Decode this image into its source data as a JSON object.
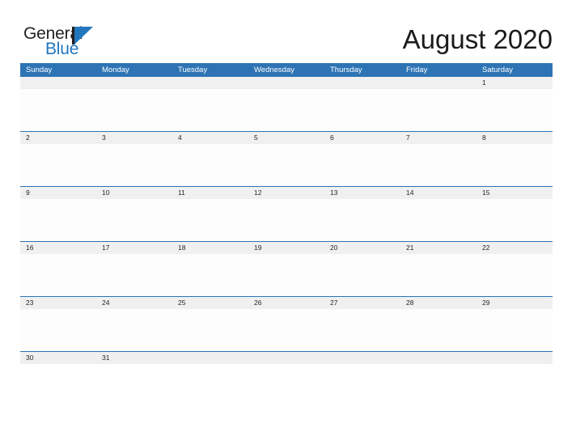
{
  "brand": {
    "word_one": "General",
    "word_two": "Blue",
    "mark": "triangle-logo-mark",
    "color_dark": "#231f20",
    "color_blue": "#2176bd"
  },
  "header": {
    "title": "August 2020"
  },
  "colors": {
    "header_blue": "#2e74b5",
    "row_gray": "#f0f0f0",
    "rule_blue": "#2e74b5",
    "page_background": "#ffffff"
  },
  "calendar": {
    "month": "August",
    "year": "2020",
    "day_headers": [
      "Sunday",
      "Monday",
      "Tuesday",
      "Wednesday",
      "Thursday",
      "Friday",
      "Saturday"
    ],
    "weeks": [
      {
        "days": [
          "",
          "",
          "",
          "",
          "",
          "",
          "1"
        ]
      },
      {
        "days": [
          "2",
          "3",
          "4",
          "5",
          "6",
          "7",
          "8"
        ]
      },
      {
        "days": [
          "9",
          "10",
          "11",
          "12",
          "13",
          "14",
          "15"
        ]
      },
      {
        "days": [
          "16",
          "17",
          "18",
          "19",
          "20",
          "21",
          "22"
        ]
      },
      {
        "days": [
          "23",
          "24",
          "25",
          "26",
          "27",
          "28",
          "29"
        ]
      },
      {
        "days": [
          "30",
          "31",
          "",
          "",
          "",
          "",
          ""
        ]
      }
    ]
  }
}
